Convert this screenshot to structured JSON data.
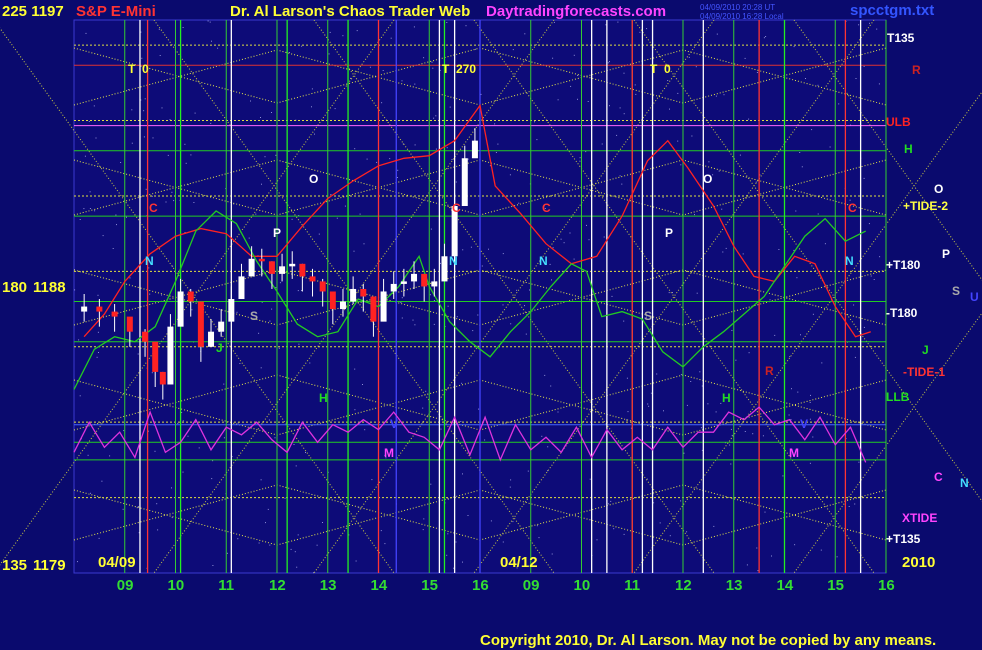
{
  "header": {
    "symbol_left": "225 1197",
    "symbol_name": "S&P E-Mini",
    "title": "Dr. Al Larson's Chaos Trader Web",
    "site": "Daytradingforecasts.com",
    "timestamp_lines": [
      "04/09/2010 20:28 UT",
      "04/09/2010 16:28 Local"
    ],
    "filename": "spcctgm.txt"
  },
  "price_axis": {
    "levels": [
      {
        "angle": "225",
        "price": "1197"
      },
      {
        "angle": "180",
        "price": "1188"
      },
      {
        "angle": "135",
        "price": "1179"
      }
    ]
  },
  "date_labels": {
    "left": "04/09",
    "middle": "04/12",
    "year": "2010"
  },
  "time_markers": [
    {
      "text": "T  0"
    },
    {
      "text": "T  270"
    },
    {
      "text": "T  0"
    }
  ],
  "right_labels": [
    {
      "text": "T135",
      "color": "#ffffff"
    },
    {
      "text": "R",
      "color": "#cc2222"
    },
    {
      "text": "ULB",
      "color": "#ff2222"
    },
    {
      "text": "H",
      "color": "#22dd22"
    },
    {
      "text": "O",
      "color": "#ffffff"
    },
    {
      "text": "+TIDE-2",
      "color": "#ffff44"
    },
    {
      "text": "P",
      "color": "#ffffff"
    },
    {
      "text": "+T180",
      "color": "#ffffff"
    },
    {
      "text": "S",
      "color": "#aaaaaa"
    },
    {
      "text": "U",
      "color": "#4444ff"
    },
    {
      "text": "-T180",
      "color": "#ffffff"
    },
    {
      "text": "J",
      "color": "#22dd22"
    },
    {
      "text": "-TIDE-1",
      "color": "#ff3333"
    },
    {
      "text": "LLB",
      "color": "#22dd22"
    },
    {
      "text": "C",
      "color": "#ff44ff"
    },
    {
      "text": "N",
      "color": "#44ddff"
    },
    {
      "text": "XTIDE",
      "color": "#ff44ff"
    },
    {
      "text": "+T135",
      "color": "#ffffff"
    }
  ],
  "chart_letters": [
    {
      "text": "C",
      "color": "#ff3333"
    },
    {
      "text": "N",
      "color": "#44ddff"
    },
    {
      "text": "O",
      "color": "#ffffff"
    },
    {
      "text": "P",
      "color": "#ffffff"
    },
    {
      "text": "S",
      "color": "#aaaaaa"
    },
    {
      "text": "H",
      "color": "#22dd22"
    },
    {
      "text": "J",
      "color": "#22dd22"
    },
    {
      "text": "V",
      "color": "#4444ff"
    },
    {
      "text": "M",
      "color": "#ff44ff"
    },
    {
      "text": "C",
      "color": "#ff3333"
    },
    {
      "text": "N",
      "color": "#44ddff"
    },
    {
      "text": "C",
      "color": "#ff3333"
    },
    {
      "text": "N",
      "color": "#44ddff"
    },
    {
      "text": "P",
      "color": "#ffffff"
    },
    {
      "text": "S",
      "color": "#aaaaaa"
    },
    {
      "text": "O",
      "color": "#ffffff"
    },
    {
      "text": "H",
      "color": "#22dd22"
    },
    {
      "text": "R",
      "color": "#cc2222"
    },
    {
      "text": "V",
      "color": "#4444ff"
    },
    {
      "text": "M",
      "color": "#ff44ff"
    },
    {
      "text": "C",
      "color": "#ff3333"
    },
    {
      "text": "N",
      "color": "#44ddff"
    }
  ],
  "footer": {
    "copyright": "Copyright 2010, Dr. Al Larson. May not be copied by any means."
  },
  "chart_data": {
    "type": "line",
    "title": "S&P E-Mini",
    "x": [
      "09",
      "10",
      "11",
      "12",
      "13",
      "14",
      "15",
      "16",
      "09",
      "10",
      "11",
      "12",
      "13",
      "14",
      "15",
      "16"
    ],
    "xlabel": "",
    "ylabel": "",
    "ylim": [
      1179,
      1197
    ],
    "y_ticks": [
      1179,
      1188,
      1197
    ],
    "price_bars": [
      {
        "hour": 8.2,
        "close": 1186.6
      },
      {
        "hour": 8.5,
        "close": 1186.4
      },
      {
        "hour": 8.8,
        "close": 1186.2
      },
      {
        "hour": 9.1,
        "close": 1185.6
      },
      {
        "hour": 9.4,
        "close": 1185.2
      },
      {
        "hour": 9.6,
        "close": 1184.0
      },
      {
        "hour": 9.75,
        "close": 1183.5
      },
      {
        "hour": 9.9,
        "close": 1185.8
      },
      {
        "hour": 10.1,
        "close": 1187.2
      },
      {
        "hour": 10.3,
        "close": 1186.8
      },
      {
        "hour": 10.5,
        "close": 1185.0
      },
      {
        "hour": 10.7,
        "close": 1185.6
      },
      {
        "hour": 10.9,
        "close": 1186.0
      },
      {
        "hour": 11.1,
        "close": 1186.9
      },
      {
        "hour": 11.3,
        "close": 1187.8
      },
      {
        "hour": 11.5,
        "close": 1188.5
      },
      {
        "hour": 11.7,
        "close": 1188.4
      },
      {
        "hour": 11.9,
        "close": 1187.9
      },
      {
        "hour": 12.1,
        "close": 1188.2
      },
      {
        "hour": 12.3,
        "close": 1188.3
      },
      {
        "hour": 12.5,
        "close": 1187.8
      },
      {
        "hour": 12.7,
        "close": 1187.6
      },
      {
        "hour": 12.9,
        "close": 1187.2
      },
      {
        "hour": 13.1,
        "close": 1186.5
      },
      {
        "hour": 13.3,
        "close": 1186.8
      },
      {
        "hour": 13.5,
        "close": 1187.3
      },
      {
        "hour": 13.7,
        "close": 1187.0
      },
      {
        "hour": 13.9,
        "close": 1186.0
      },
      {
        "hour": 14.1,
        "close": 1187.2
      },
      {
        "hour": 14.3,
        "close": 1187.5
      },
      {
        "hour": 14.5,
        "close": 1187.6
      },
      {
        "hour": 14.7,
        "close": 1187.9
      },
      {
        "hour": 14.9,
        "close": 1187.4
      },
      {
        "hour": 15.1,
        "close": 1187.6
      },
      {
        "hour": 15.3,
        "close": 1188.6
      },
      {
        "hour": 15.5,
        "close": 1190.6
      },
      {
        "hour": 15.7,
        "close": 1192.5
      },
      {
        "hour": 15.9,
        "close": 1193.2
      }
    ],
    "series": [
      {
        "name": "ULB",
        "color": "#ff2222",
        "values": [
          [
            8.2,
            1185.4
          ],
          [
            8.6,
            1186.3
          ],
          [
            9.0,
            1187.6
          ],
          [
            9.5,
            1188.7
          ],
          [
            10.0,
            1189.4
          ],
          [
            10.5,
            1189.7
          ],
          [
            11.0,
            1189.5
          ],
          [
            11.5,
            1188.6
          ],
          [
            12.0,
            1188.6
          ],
          [
            12.5,
            1189.8
          ],
          [
            13.0,
            1190.9
          ],
          [
            13.5,
            1191.6
          ],
          [
            14.0,
            1192.2
          ],
          [
            14.5,
            1192.5
          ],
          [
            15.0,
            1192.6
          ],
          [
            15.5,
            1193.2
          ],
          [
            16.0,
            1194.6
          ],
          [
            16.3,
            1191.4
          ],
          [
            16.8,
            1190.3
          ],
          [
            17.3,
            1189.1
          ],
          [
            17.8,
            1188.3
          ],
          [
            18.3,
            1188.6
          ],
          [
            18.8,
            1190.2
          ],
          [
            19.3,
            1192.4
          ],
          [
            19.7,
            1193.2
          ],
          [
            20.1,
            1192.1
          ],
          [
            20.6,
            1190.6
          ],
          [
            21.0,
            1189.0
          ],
          [
            21.4,
            1187.8
          ],
          [
            21.8,
            1187.6
          ],
          [
            22.2,
            1188.6
          ],
          [
            22.6,
            1188.3
          ],
          [
            23.0,
            1186.6
          ],
          [
            23.4,
            1185.4
          ],
          [
            23.7,
            1185.6
          ]
        ]
      },
      {
        "name": "LLB",
        "color": "#22cc22",
        "values": [
          [
            8.0,
            1183.3
          ],
          [
            8.4,
            1184.9
          ],
          [
            8.8,
            1185.4
          ],
          [
            9.2,
            1185.2
          ],
          [
            9.6,
            1185.8
          ],
          [
            10.0,
            1187.6
          ],
          [
            10.4,
            1189.6
          ],
          [
            10.8,
            1190.4
          ],
          [
            11.2,
            1189.9
          ],
          [
            11.6,
            1188.4
          ],
          [
            12.0,
            1187.2
          ],
          [
            12.4,
            1185.9
          ],
          [
            12.8,
            1185.4
          ],
          [
            13.2,
            1185.6
          ],
          [
            13.6,
            1186.9
          ],
          [
            14.0,
            1186.6
          ],
          [
            14.4,
            1187.4
          ],
          [
            14.8,
            1188.6
          ],
          [
            15.0,
            1187.4
          ],
          [
            15.4,
            1186.0
          ],
          [
            15.8,
            1185.2
          ],
          [
            16.2,
            1184.6
          ],
          [
            16.6,
            1185.6
          ],
          [
            17.0,
            1186.4
          ],
          [
            17.4,
            1187.4
          ],
          [
            17.8,
            1188.3
          ],
          [
            18.1,
            1188.0
          ],
          [
            18.4,
            1186.2
          ],
          [
            18.8,
            1186.4
          ],
          [
            19.2,
            1186.1
          ],
          [
            19.6,
            1184.8
          ],
          [
            20.0,
            1184.2
          ],
          [
            20.4,
            1185.0
          ],
          [
            20.8,
            1185.6
          ],
          [
            21.2,
            1186.3
          ],
          [
            21.6,
            1187.0
          ],
          [
            22.0,
            1188.2
          ],
          [
            22.4,
            1189.4
          ],
          [
            22.8,
            1190.1
          ],
          [
            23.2,
            1189.2
          ],
          [
            23.6,
            1189.6
          ]
        ]
      },
      {
        "name": "XTIDE",
        "color": "#dd33dd",
        "values": [
          [
            8.0,
            1180.8
          ],
          [
            8.3,
            1182.0
          ],
          [
            8.6,
            1181.0
          ],
          [
            8.9,
            1181.6
          ],
          [
            9.2,
            1180.6
          ],
          [
            9.5,
            1182.4
          ],
          [
            9.8,
            1180.8
          ],
          [
            10.1,
            1181.2
          ],
          [
            10.4,
            1182.1
          ],
          [
            10.7,
            1180.9
          ],
          [
            11.0,
            1181.8
          ],
          [
            11.3,
            1181.5
          ],
          [
            11.6,
            1182.0
          ],
          [
            11.9,
            1181.3
          ],
          [
            12.2,
            1180.8
          ],
          [
            12.5,
            1182.0
          ],
          [
            12.8,
            1181.2
          ],
          [
            13.1,
            1181.9
          ],
          [
            13.4,
            1181.6
          ],
          [
            13.7,
            1182.1
          ],
          [
            14.0,
            1181.7
          ],
          [
            14.3,
            1182.4
          ],
          [
            14.6,
            1181.6
          ],
          [
            14.9,
            1181.4
          ],
          [
            15.2,
            1180.9
          ],
          [
            15.5,
            1182.2
          ],
          [
            15.8,
            1180.7
          ],
          [
            16.1,
            1182.2
          ],
          [
            16.4,
            1180.5
          ],
          [
            16.7,
            1181.9
          ],
          [
            17.0,
            1180.9
          ],
          [
            17.3,
            1181.4
          ],
          [
            17.6,
            1180.8
          ],
          [
            17.9,
            1181.8
          ],
          [
            18.2,
            1180.6
          ],
          [
            18.5,
            1181.7
          ],
          [
            18.8,
            1180.9
          ],
          [
            19.1,
            1181.4
          ],
          [
            19.4,
            1180.9
          ],
          [
            19.7,
            1181.8
          ],
          [
            20.0,
            1181.0
          ],
          [
            20.3,
            1181.6
          ],
          [
            20.6,
            1181.6
          ],
          [
            20.9,
            1182.4
          ],
          [
            21.2,
            1182.1
          ],
          [
            21.5,
            1182.6
          ],
          [
            21.8,
            1181.9
          ],
          [
            22.1,
            1182.1
          ],
          [
            22.4,
            1181.3
          ],
          [
            22.7,
            1182.2
          ],
          [
            23.0,
            1181.1
          ],
          [
            23.3,
            1181.8
          ],
          [
            23.6,
            1180.4
          ]
        ]
      }
    ],
    "grid": true,
    "legend": "right"
  }
}
